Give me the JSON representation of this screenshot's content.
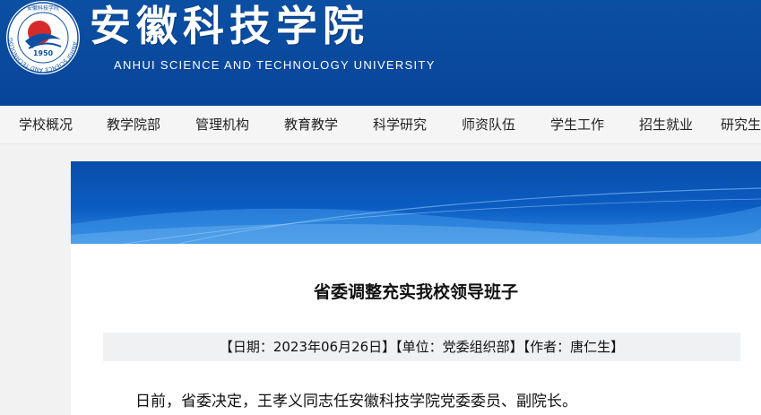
{
  "brand": {
    "name_cn": "安徽科技学院",
    "name_en": "ANHUI SCIENCE AND TECHNOLOGY UNIVERSITY",
    "logo_year": "1950",
    "logo_ring_text": "ANHUI SCIENCE AND TECHNOLOGY UNIVERSITY",
    "logo_top_text": "安徽科技学院"
  },
  "nav": {
    "items": [
      "学校概况",
      "教学院部",
      "管理机构",
      "教育教学",
      "科学研究",
      "师资队伍",
      "学生工作",
      "招生就业",
      "研究生"
    ]
  },
  "article": {
    "title": "省委调整充实我校领导班子",
    "meta": "【日期：2023年06月26日】【单位：党委组织部】【作者：唐仁生】",
    "paragraph": "日前，省委决定，王孝义同志任安徽科技学院党委委员、副院长。"
  },
  "colors": {
    "header_blue": "#0b4fa3",
    "banner_blue": "#0a55b8"
  }
}
